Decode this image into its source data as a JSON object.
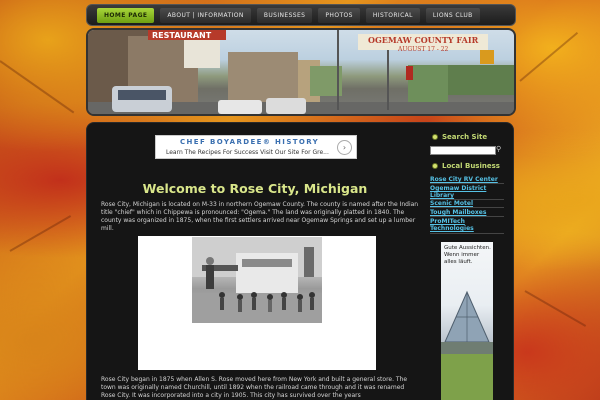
{
  "nav": {
    "items": [
      {
        "label": "HOME PAGE",
        "active": true
      },
      {
        "label": "ABOUT | INFORMATION",
        "active": false
      },
      {
        "label": "BUSINESSES",
        "active": false
      },
      {
        "label": "PHOTOS",
        "active": false
      },
      {
        "label": "HISTORICAL",
        "active": false
      },
      {
        "label": "LIONS CLUB",
        "active": false
      }
    ]
  },
  "header": {
    "restaurant_sign": "RESTAURANT",
    "fair_banner": "OGEMAW COUNTY FAIR",
    "fair_dates": "AUGUST 17 - 22"
  },
  "ad_banner": {
    "title": "CHEF BOYARDEE® HISTORY",
    "subtitle": "Learn The Recipes For Success Visit Our Site For Gre...",
    "arrow": "›"
  },
  "main": {
    "title": "Welcome to Rose City, Michigan",
    "paragraph1": "Rose City, Michigan is located on M-33 in northern Ogemaw County. The county is named after the Indian title \"chief\" which in Chippewa is pronounced: \"Ogema.\" The land was originally platted in 1840. The county was organized in 1875, when the first settlers arrived near Ogemaw Springs and set up a lumber mill.",
    "paragraph2": "Rose City began in 1875 when Allen S. Rose moved here from New York and built a general store. The town was originally named Churchill, until 1892 when the railroad came through and it was renamed Rose City. It was incorporated into a city in 1905. This city has survived over the years"
  },
  "sidebar": {
    "search_heading": "Search Site",
    "search_placeholder": "",
    "search_icon": "magnifier-icon",
    "business_heading": "Local Business",
    "business_links": [
      "Rose City RV Center",
      "Ogemaw District Library",
      "Scenic Motel",
      "Tough Mailboxes",
      "ProMITech Technologies"
    ],
    "ad_text": "Gute Aussichten. Wenn immer alles läuft."
  },
  "colors": {
    "accent_green": "#a8d63a",
    "title_yellow": "#d9e68a",
    "link_blue": "#56c2e6",
    "panel_black": "#151515"
  }
}
